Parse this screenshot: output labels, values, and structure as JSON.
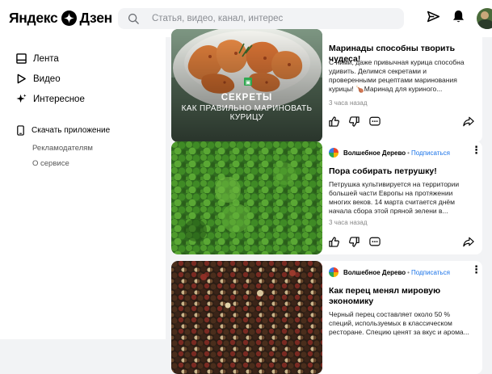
{
  "brand": {
    "logo_left": "Яндекс",
    "logo_right": "Дзен"
  },
  "search": {
    "placeholder": "Статья, видео, канал, интерес"
  },
  "sidebar": {
    "items": [
      {
        "label": "Лента",
        "icon": "home-icon"
      },
      {
        "label": "Видео",
        "icon": "play-icon"
      },
      {
        "label": "Интересное",
        "icon": "sparkle-icon"
      }
    ],
    "download_label": "Скачать приложение",
    "links": [
      "Рекламодателям",
      "О сервисе"
    ]
  },
  "cards": [
    {
      "title": "Маринады способны творить чудеса!",
      "text": "С ними, даже привычная курица способна удивить. Делимся секретами и проверенными рецептами маринования курицы! 🍗Маринад для куриного...",
      "time": "3 часа назад",
      "overlay_badge": "СЕКРЕТЫ",
      "overlay_text": "КАК ПРАВИЛЬНО МАРИНОВАТЬ КУРИЦУ"
    },
    {
      "channel": "Волшебное Дерево",
      "subscribe": "Подписаться",
      "title": "Пора собирать петрушку!",
      "text": "Петрушка культивируется на территории большей части Европы на протяжении многих веков. 14 марта считается днём начала сбора этой пряной зелени в...",
      "time": "3 часа назад"
    },
    {
      "channel": "Волшебное Дерево",
      "subscribe": "Подписаться",
      "title": "Как перец менял мировую экономику",
      "text": "Черный перец составляет около 50 % специй, используемых в классическом ресторане. Специю ценят за вкус и арома..."
    }
  ],
  "colors": {
    "accent_link": "#1a73e8",
    "page_bg": "#f2f3f5"
  }
}
